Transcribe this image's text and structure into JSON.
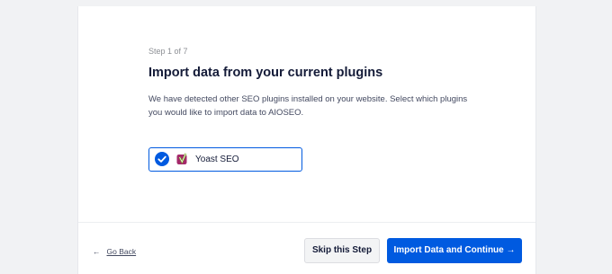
{
  "wizard": {
    "step_label": "Step 1 of 7",
    "title": "Import data from your current plugins",
    "description": "We have detected other SEO plugins installed on your website. Select which plugins you would like to import data to AIOSEO."
  },
  "plugins": [
    {
      "label": "Yoast SEO",
      "checked": true,
      "icon": "yoast-logo-icon"
    }
  ],
  "footer": {
    "back_arrow": "←",
    "back_label": "Go Back",
    "skip_label": "Skip this Step",
    "continue_label": "Import Data and Continue →"
  },
  "colors": {
    "accent": "#005ae0",
    "title": "#141b38",
    "page_bg": "#f1f2f4"
  }
}
